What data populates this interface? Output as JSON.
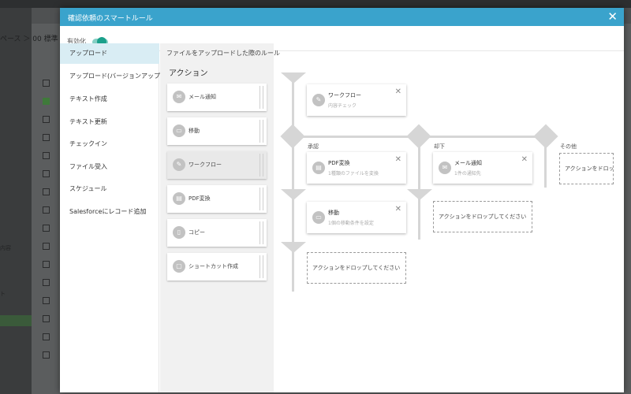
{
  "background": {
    "breadcrumb": "ペース ＞ 00 標準",
    "side_text_1": "内容",
    "side_text_2": "ト"
  },
  "modal": {
    "title": "確認依頼のスマートルール",
    "enable_label": "有効化",
    "toggle_on": true
  },
  "rules": [
    "アップロード",
    "アップロード(バージョンアップ)",
    "テキスト作成",
    "テキスト更新",
    "チェックイン",
    "ファイル受入",
    "スケジュール",
    "Salesforceにレコード追加"
  ],
  "rule_heading": "ファイルをアップロードした際のルール",
  "actions": {
    "title": "アクション",
    "items": [
      {
        "label": "メール通知",
        "icon": "mail-icon"
      },
      {
        "label": "移動",
        "icon": "move-icon"
      },
      {
        "label": "ワークフロー",
        "icon": "workflow-icon"
      },
      {
        "label": "PDF変換",
        "icon": "pdf-icon"
      },
      {
        "label": "コピー",
        "icon": "copy-icon"
      },
      {
        "label": "ショートカット作成",
        "icon": "shortcut-icon"
      }
    ]
  },
  "flow": {
    "workflow_card": {
      "title": "ワークフロー",
      "sub": "内容チェック"
    },
    "branches": {
      "approve": "承認",
      "reject": "却下",
      "other": "その他"
    },
    "approve_cards": [
      {
        "title": "PDF変換",
        "sub": "1種類のファイルを変換"
      },
      {
        "title": "移動",
        "sub": "1個の移動条件を設定"
      }
    ],
    "reject_card": {
      "title": "メール通知",
      "sub": "1件の通知先"
    },
    "drop_text": "アクションをドロップしてください",
    "close_symbol": "✕"
  }
}
